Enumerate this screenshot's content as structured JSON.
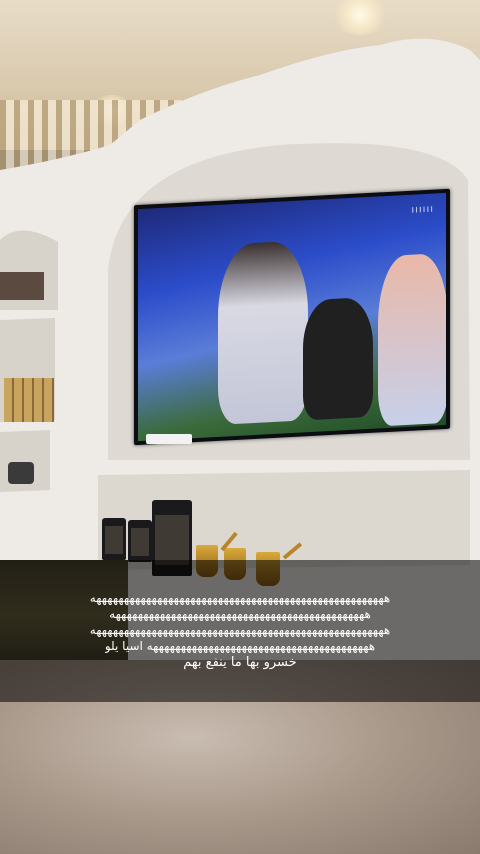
{
  "tv": {
    "channel_logo": "ıııııı",
    "scene": "stadium-broadcast"
  },
  "caption": {
    "lines": [
      "هههههههههههههههههههههههههههههههههههههههههههههههههههههه",
      "ههههههههههههههههههههههههههههههههههههههههههههههه",
      "هههههههههههههههههههههههههههههههههههههههههههههههههههههه",
      "ههههههههههههههههههههههههههههههههههههههههه اسيا يلو",
      "خسرو بها ما ينفع بهم"
    ]
  },
  "colors": {
    "caption_bg": "#00000088",
    "caption_text": "#ffffff",
    "wall": "#ece9e4",
    "tv_screen": "#2b4cc9"
  }
}
